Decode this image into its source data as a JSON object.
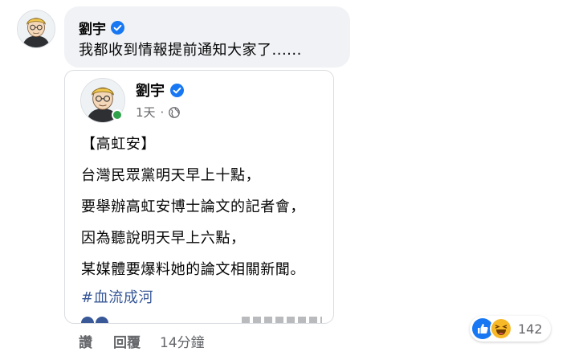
{
  "comment": {
    "author": "劉宇",
    "text": "我都收到情報提前通知大家了......",
    "actions": {
      "like_label": "讚",
      "reply_label": "回覆",
      "time": "14分鐘"
    },
    "reactions": {
      "types": [
        "like-icon",
        "haha-icon"
      ],
      "count": "142"
    }
  },
  "shared_post": {
    "author": "劉宇",
    "time": "1天",
    "separator": "·",
    "lines": [
      "【高虹安】",
      "台灣民眾黨明天早上十點，",
      "要舉辦高虹安博士論文的記者會，",
      "因為聽說明天早上六點，",
      "某媒體要爆料她的論文相關新聞。"
    ],
    "hashtag": "#血流成河"
  },
  "colors": {
    "bubble_bg": "#f0f2f5",
    "verified": "#1877f2",
    "hashtag": "#385898",
    "online": "#31a24c",
    "secondary_text": "#65676b"
  }
}
